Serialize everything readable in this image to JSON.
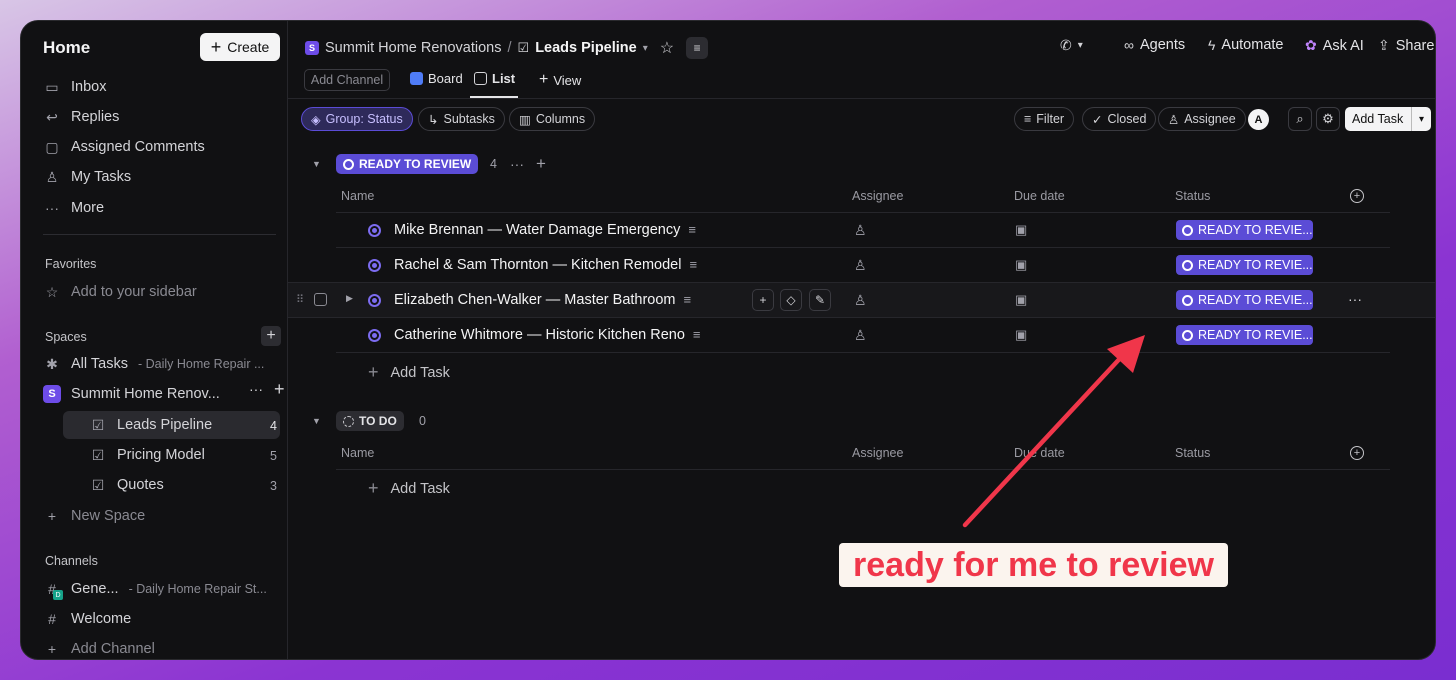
{
  "sidebar": {
    "home_title": "Home",
    "create_label": "Create",
    "nav": [
      {
        "label": "Inbox",
        "icon": "inbox-icon"
      },
      {
        "label": "Replies",
        "icon": "reply-icon"
      },
      {
        "label": "Assigned Comments",
        "icon": "comment-icon"
      },
      {
        "label": "My Tasks",
        "icon": "user-icon"
      },
      {
        "label": "More",
        "icon": "more-icon"
      }
    ],
    "favorites_label": "Favorites",
    "favorites_add": "Add to your sidebar",
    "spaces_label": "Spaces",
    "all_tasks": "All Tasks",
    "all_tasks_sub": "- Daily Home Repair ...",
    "space_badge": "S",
    "space_name": "Summit Home Renov...",
    "lists": [
      {
        "label": "Leads Pipeline",
        "count": "4"
      },
      {
        "label": "Pricing Model",
        "count": "5"
      },
      {
        "label": "Quotes",
        "count": "3"
      }
    ],
    "new_space": "New Space",
    "channels_label": "Channels",
    "channels": [
      {
        "label": "Gene...",
        "sub": "- Daily Home Repair St...",
        "badge": "D"
      },
      {
        "label": "Welcome"
      }
    ],
    "add_channel": "Add Channel"
  },
  "topbar": {
    "space_badge": "S",
    "space_name": "Summit Home Renovations",
    "separator": "/",
    "list_name": "Leads Pipeline",
    "actions": {
      "agents": "Agents",
      "automate": "Automate",
      "ask_ai": "Ask AI",
      "share": "Share"
    }
  },
  "tabs": {
    "add_channel": "Add Channel",
    "board": "Board",
    "list": "List",
    "view": "View"
  },
  "toolbar": {
    "group": "Group: Status",
    "subtasks": "Subtasks",
    "columns": "Columns",
    "filter": "Filter",
    "closed": "Closed",
    "assignee": "Assignee",
    "avatar": "A",
    "add_task": "Add Task"
  },
  "columns": {
    "name": "Name",
    "assignee": "Assignee",
    "due_date": "Due date",
    "status": "Status"
  },
  "groups": {
    "review": {
      "label": "READY TO REVIEW",
      "count": "4",
      "tasks": [
        {
          "name": "Mike Brennan — Water Damage Emergency",
          "status": "READY TO REVIE..."
        },
        {
          "name": "Rachel & Sam Thornton — Kitchen Remodel",
          "status": "READY TO REVIE..."
        },
        {
          "name": "Elizabeth Chen-Walker — Master Bathroom",
          "status": "READY TO REVIE..."
        },
        {
          "name": "Catherine Whitmore — Historic Kitchen Reno",
          "status": "READY TO REVIE..."
        }
      ],
      "add_task": "Add Task"
    },
    "todo": {
      "label": "TO DO",
      "count": "0",
      "add_task": "Add Task"
    }
  },
  "annotation": {
    "text": "ready for me to review",
    "color": "#f0364a"
  },
  "colors": {
    "accent": "#5b4cd6",
    "background": "#111113"
  }
}
